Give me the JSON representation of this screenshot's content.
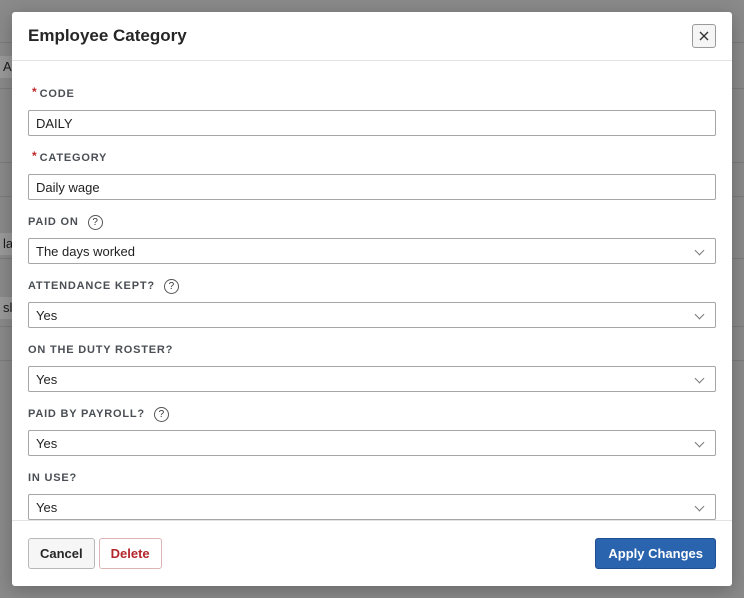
{
  "backdrop": {
    "fragments": [
      "Ac",
      "lar",
      "sl"
    ]
  },
  "dialog": {
    "title": "Employee Category",
    "close_icon": "close-icon",
    "fields": {
      "code": {
        "label": "CODE",
        "value": "DAILY",
        "required": true
      },
      "category": {
        "label": "CATEGORY",
        "value": "Daily wage",
        "required": true
      },
      "paid_on": {
        "label": "PAID ON",
        "value": "The days worked",
        "help": "?"
      },
      "attendance_kept": {
        "label": "ATTENDANCE KEPT?",
        "value": "Yes",
        "help": "?"
      },
      "duty_roster": {
        "label": "ON THE DUTY ROSTER?",
        "value": "Yes"
      },
      "paid_by_payroll": {
        "label": "PAID BY PAYROLL?",
        "value": "Yes",
        "help": "?"
      },
      "in_use": {
        "label": "IN USE?",
        "value": "Yes"
      }
    },
    "required_marker": "*",
    "footer": {
      "cancel_label": "Cancel",
      "delete_label": "Delete",
      "apply_label": "Apply Changes"
    }
  },
  "colors": {
    "primary": "#2a63ae",
    "danger": "#b3262c",
    "required": "#c0262c"
  }
}
